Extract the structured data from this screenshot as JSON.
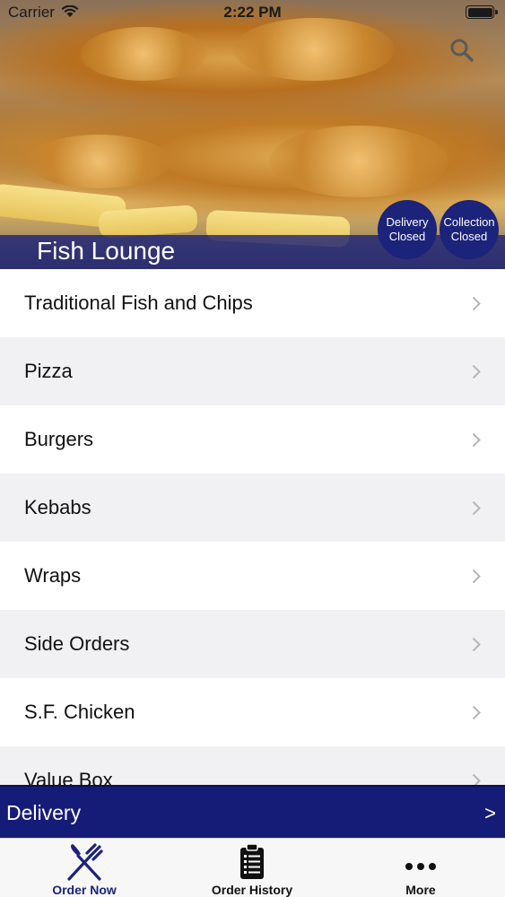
{
  "status_bar": {
    "carrier": "Carrier",
    "time": "2:22 PM",
    "battery_level": 1.0
  },
  "header": {
    "restaurant_name": "Fish Lounge",
    "search_icon": "search-icon",
    "delivery_status": {
      "line1": "Delivery",
      "line2": "Closed"
    },
    "collection_status": {
      "line1": "Collection",
      "line2": "Closed"
    }
  },
  "categories": [
    {
      "label": "Traditional Fish and Chips"
    },
    {
      "label": "Pizza"
    },
    {
      "label": "Burgers"
    },
    {
      "label": "Kebabs"
    },
    {
      "label": "Wraps"
    },
    {
      "label": "Side Orders"
    },
    {
      "label": "S.F. Chicken"
    },
    {
      "label": "Value Box"
    }
  ],
  "delivery_bar": {
    "label": "Delivery",
    "arrow": ">"
  },
  "tab_bar": {
    "tabs": [
      {
        "label": "Order Now",
        "icon": "fork-knife-icon",
        "selected": true
      },
      {
        "label": "Order History",
        "icon": "clipboard-list-icon",
        "selected": false
      },
      {
        "label": "More",
        "icon": "more-dots-icon",
        "selected": false
      }
    ]
  },
  "colors": {
    "accent": "#1b237a",
    "delivery_bar": "#151c78",
    "row_alt": "#f1f1f3"
  }
}
